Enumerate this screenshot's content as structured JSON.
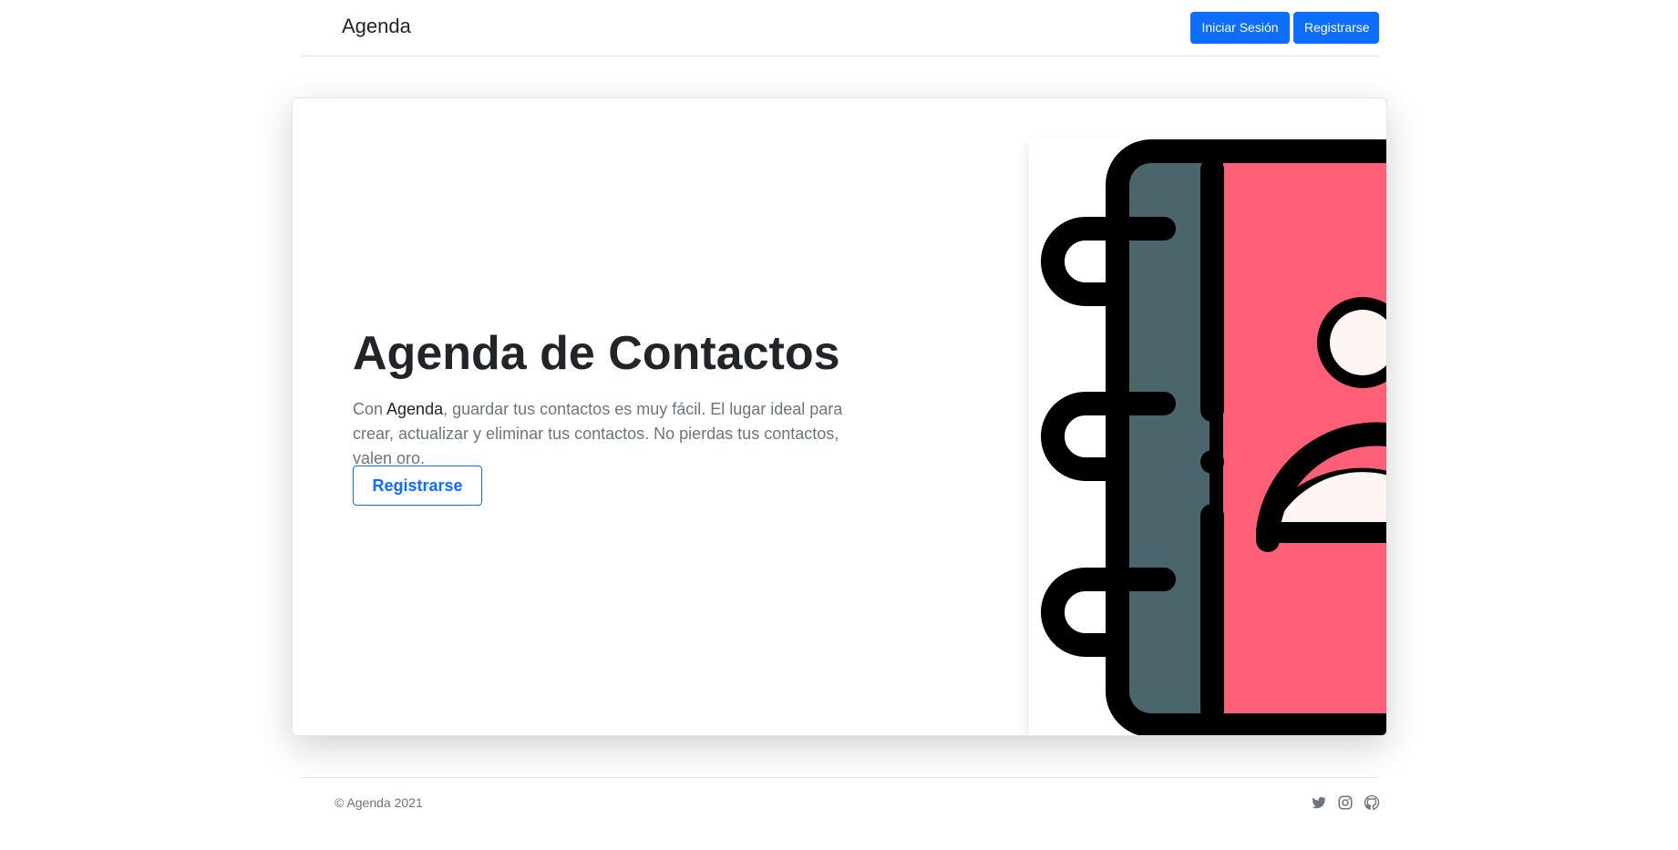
{
  "header": {
    "brand": "Agenda",
    "login_label": "Iniciar Sesión",
    "register_label": "Registrarse"
  },
  "hero": {
    "title": "Agenda de Contactos",
    "text_prefix": "Con ",
    "text_highlight": "Agenda",
    "text_suffix": ", guardar tus contactos es muy fácil. El lugar ideal para crear, actualizar y eliminar tus contactos. No pierdas tus contactos, valen oro.",
    "cta_label": "Registrarse",
    "illustration_icon": "address-book-icon"
  },
  "footer": {
    "copyright": "© Agenda 2021",
    "social_icons": [
      "twitter-icon",
      "instagram-icon",
      "github-icon"
    ]
  },
  "colors": {
    "primary": "#0d6efd",
    "book_cover": "#ff6078",
    "book_spine": "#4a666c",
    "person": "#fff5f3",
    "outline": "#000000"
  }
}
